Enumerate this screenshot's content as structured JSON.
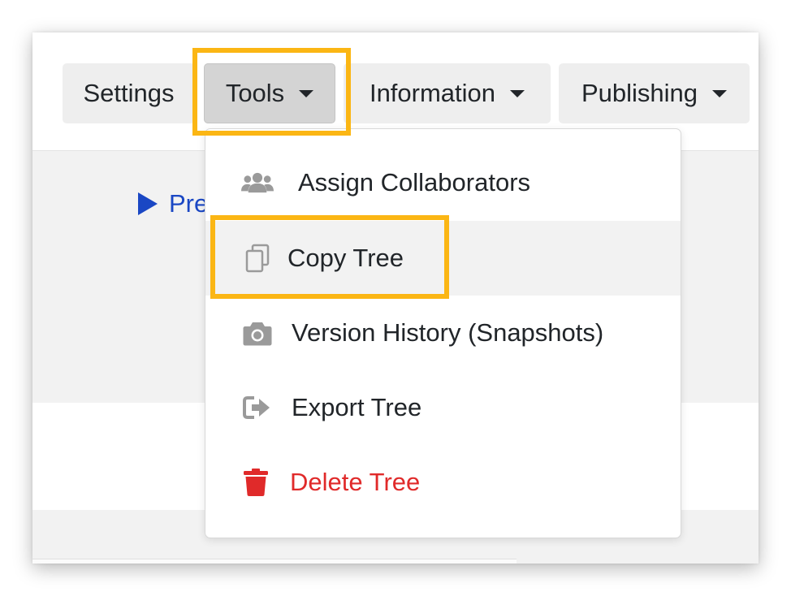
{
  "toolbar": {
    "tabs": [
      {
        "label": "Settings",
        "has_caret": false
      },
      {
        "label": "Tools",
        "has_caret": true,
        "active": true
      },
      {
        "label": "Information",
        "has_caret": true
      },
      {
        "label": "Publishing",
        "has_caret": true
      }
    ]
  },
  "content": {
    "preview_label": "Pre"
  },
  "tools_menu": {
    "items": [
      {
        "label": "Assign Collaborators",
        "icon": "users-icon"
      },
      {
        "label": "Copy Tree",
        "icon": "copy-icon",
        "highlighted": true
      },
      {
        "label": "Version History (Snapshots)",
        "icon": "camera-icon"
      },
      {
        "label": "Export Tree",
        "icon": "export-icon"
      },
      {
        "label": "Delete Tree",
        "icon": "trash-icon",
        "danger": true
      }
    ]
  },
  "colors": {
    "highlight": "#fbb614",
    "link": "#1a47c4",
    "danger": "#e02a2a",
    "icon_grey": "#9a9a9a"
  }
}
